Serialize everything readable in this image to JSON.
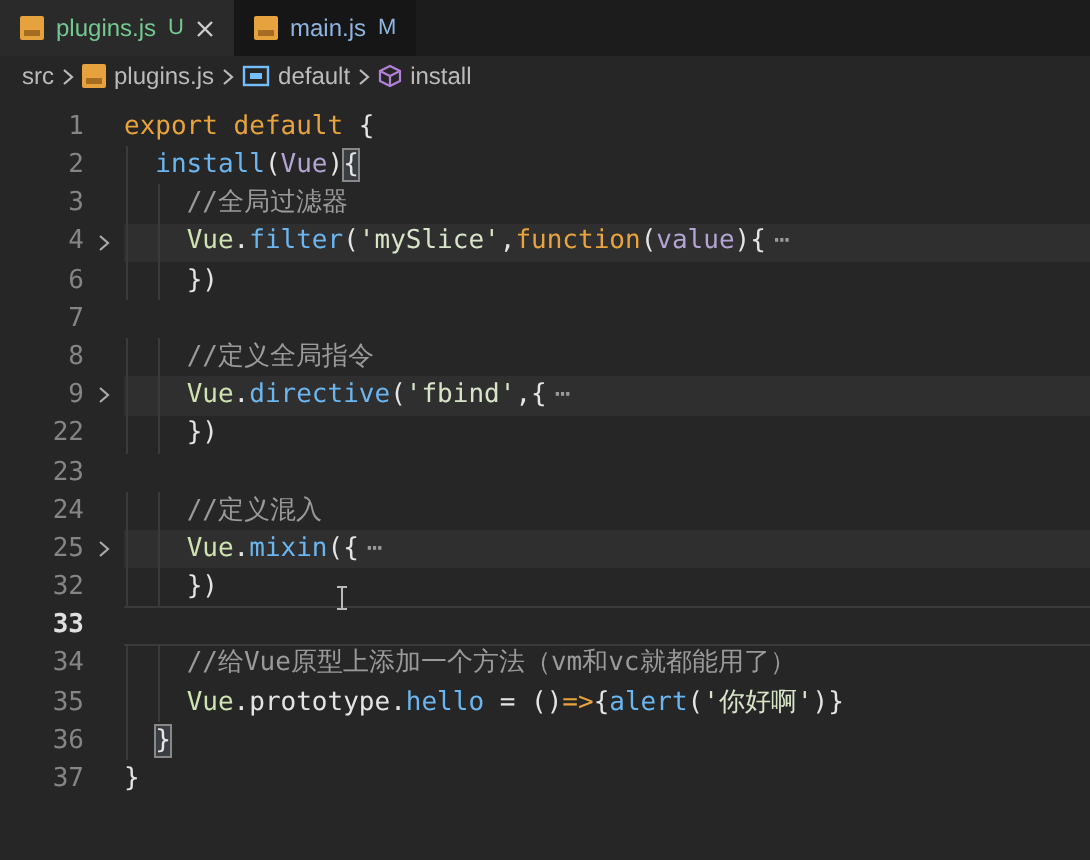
{
  "tabs": [
    {
      "label": "plugins.js",
      "status": "U",
      "kind": "untracked",
      "selected": true,
      "closable": true
    },
    {
      "label": "main.js",
      "status": "M",
      "kind": "modified",
      "selected": false,
      "closable": false
    }
  ],
  "breadcrumb": [
    {
      "label": "src",
      "kind": "folder"
    },
    {
      "label": "plugins.js",
      "kind": "file"
    },
    {
      "label": "default",
      "kind": "variable"
    },
    {
      "label": "install",
      "kind": "method"
    }
  ],
  "lines": [
    {
      "number": "1",
      "tokens": [
        {
          "t": "export default ",
          "kind": "kw"
        },
        {
          "t": "{",
          "kind": "punct"
        }
      ]
    },
    {
      "number": "2",
      "tokens": [
        {
          "t": "  install",
          "kind": "fn"
        },
        {
          "t": "(",
          "kind": "punct"
        },
        {
          "t": "Vue",
          "kind": "param"
        },
        {
          "t": ")",
          "kind": "punct"
        },
        {
          "t": "{",
          "kind": "match"
        }
      ]
    },
    {
      "number": "3",
      "tokens": [
        {
          "t": "    //全局过滤器",
          "kind": "comment"
        }
      ]
    },
    {
      "number": "4",
      "folded": true,
      "tokens": [
        {
          "t": "    Vue",
          "kind": "obj"
        },
        {
          "t": ".",
          "kind": "punct"
        },
        {
          "t": "filter",
          "kind": "fn"
        },
        {
          "t": "(",
          "kind": "punct"
        },
        {
          "t": "'mySlice'",
          "kind": "str"
        },
        {
          "t": ",",
          "kind": "punct"
        },
        {
          "t": "function",
          "kind": "kw"
        },
        {
          "t": "(",
          "kind": "punct"
        },
        {
          "t": "value",
          "kind": "param"
        },
        {
          "t": "){",
          "kind": "punct"
        },
        {
          "t": "⋯",
          "kind": "fold"
        }
      ]
    },
    {
      "number": "6",
      "tokens": [
        {
          "t": "    })",
          "kind": "punct"
        }
      ]
    },
    {
      "number": "7"
    },
    {
      "number": "8",
      "tokens": [
        {
          "t": "    //定义全局指令",
          "kind": "comment"
        }
      ]
    },
    {
      "number": "9",
      "folded": true,
      "tokens": [
        {
          "t": "    Vue",
          "kind": "obj"
        },
        {
          "t": ".",
          "kind": "punct"
        },
        {
          "t": "directive",
          "kind": "fn"
        },
        {
          "t": "(",
          "kind": "punct"
        },
        {
          "t": "'fbind'",
          "kind": "str"
        },
        {
          "t": ",{",
          "kind": "punct"
        },
        {
          "t": "⋯",
          "kind": "fold"
        }
      ]
    },
    {
      "number": "22",
      "tokens": [
        {
          "t": "    })",
          "kind": "punct"
        }
      ]
    },
    {
      "number": "23"
    },
    {
      "number": "24",
      "tokens": [
        {
          "t": "    //定义混入",
          "kind": "comment"
        }
      ]
    },
    {
      "number": "25",
      "folded": true,
      "tokens": [
        {
          "t": "    Vue",
          "kind": "obj"
        },
        {
          "t": ".",
          "kind": "punct"
        },
        {
          "t": "mixin",
          "kind": "fn"
        },
        {
          "t": "({",
          "kind": "punct"
        },
        {
          "t": "⋯",
          "kind": "fold"
        }
      ]
    },
    {
      "number": "32",
      "tokens": [
        {
          "t": "    })",
          "kind": "punct"
        }
      ]
    },
    {
      "number": "33",
      "current": true
    },
    {
      "number": "34",
      "tokens": [
        {
          "t": "    //给Vue原型上添加一个方法（vm和vc就都能用了）",
          "kind": "comment"
        }
      ]
    },
    {
      "number": "35",
      "tokens": [
        {
          "t": "    Vue",
          "kind": "obj"
        },
        {
          "t": ".prototype.",
          "kind": "punct"
        },
        {
          "t": "hello",
          "kind": "fn"
        },
        {
          "t": " = ()",
          "kind": "punct"
        },
        {
          "t": "=>",
          "kind": "kw"
        },
        {
          "t": "{",
          "kind": "punct"
        },
        {
          "t": "alert",
          "kind": "fn"
        },
        {
          "t": "(",
          "kind": "punct"
        },
        {
          "t": "'你好啊'",
          "kind": "str"
        },
        {
          "t": ")}",
          "kind": "punct"
        }
      ]
    },
    {
      "number": "36",
      "tokens": [
        {
          "t": "  }",
          "kind": "match"
        }
      ]
    },
    {
      "number": "37",
      "tokens": [
        {
          "t": "}",
          "kind": "punct"
        }
      ]
    }
  ]
}
